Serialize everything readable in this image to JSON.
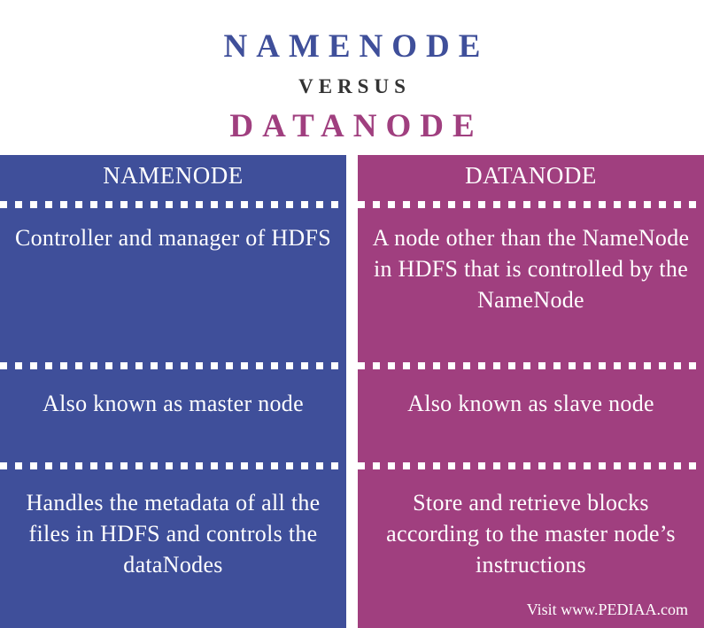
{
  "colors": {
    "namenode": "#3f4f9a",
    "datanode": "#a03f7f",
    "versus": "#333333",
    "background": "#ffffff"
  },
  "title": {
    "top": "NAMENODE",
    "versus": "VERSUS",
    "bottom": "DATANODE"
  },
  "columns": {
    "left": {
      "header": "NAMENODE",
      "cells": [
        "Controller and manager of HDFS",
        "Also known as master node",
        "Handles the metadata of all the files in HDFS and controls the dataNodes"
      ]
    },
    "right": {
      "header": "DATANODE",
      "cells": [
        "A node other than the NameNode in HDFS that is controlled by the NameNode",
        "Also known as slave node",
        "Store and retrieve blocks according to the master node’s instructions"
      ]
    }
  },
  "footer": {
    "source": "Visit www.PEDIAA.com"
  }
}
